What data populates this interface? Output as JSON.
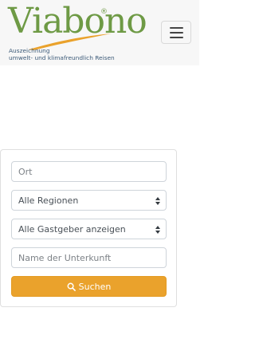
{
  "header": {
    "logo": {
      "wordmark": "Viabono",
      "registered": "®",
      "tagline_line1": "Auszeichnung",
      "tagline_line2": "umwelt- und klimafreundlich Reisen",
      "colors": {
        "wordmark": "#6e9a45",
        "swoosh": "#eaa22c",
        "tagline": "#3c5a78"
      }
    },
    "menu_icon": "hamburger-menu-icon"
  },
  "search": {
    "ort_placeholder": "Ort",
    "region_selected": "Alle Regionen",
    "gastgeber_selected": "Alle Gastgeber anzeigen",
    "unterkunft_placeholder": "Name der Unterkunft",
    "button_label": "Suchen",
    "button_icon": "search-icon",
    "button_color": "#eaa22c"
  }
}
